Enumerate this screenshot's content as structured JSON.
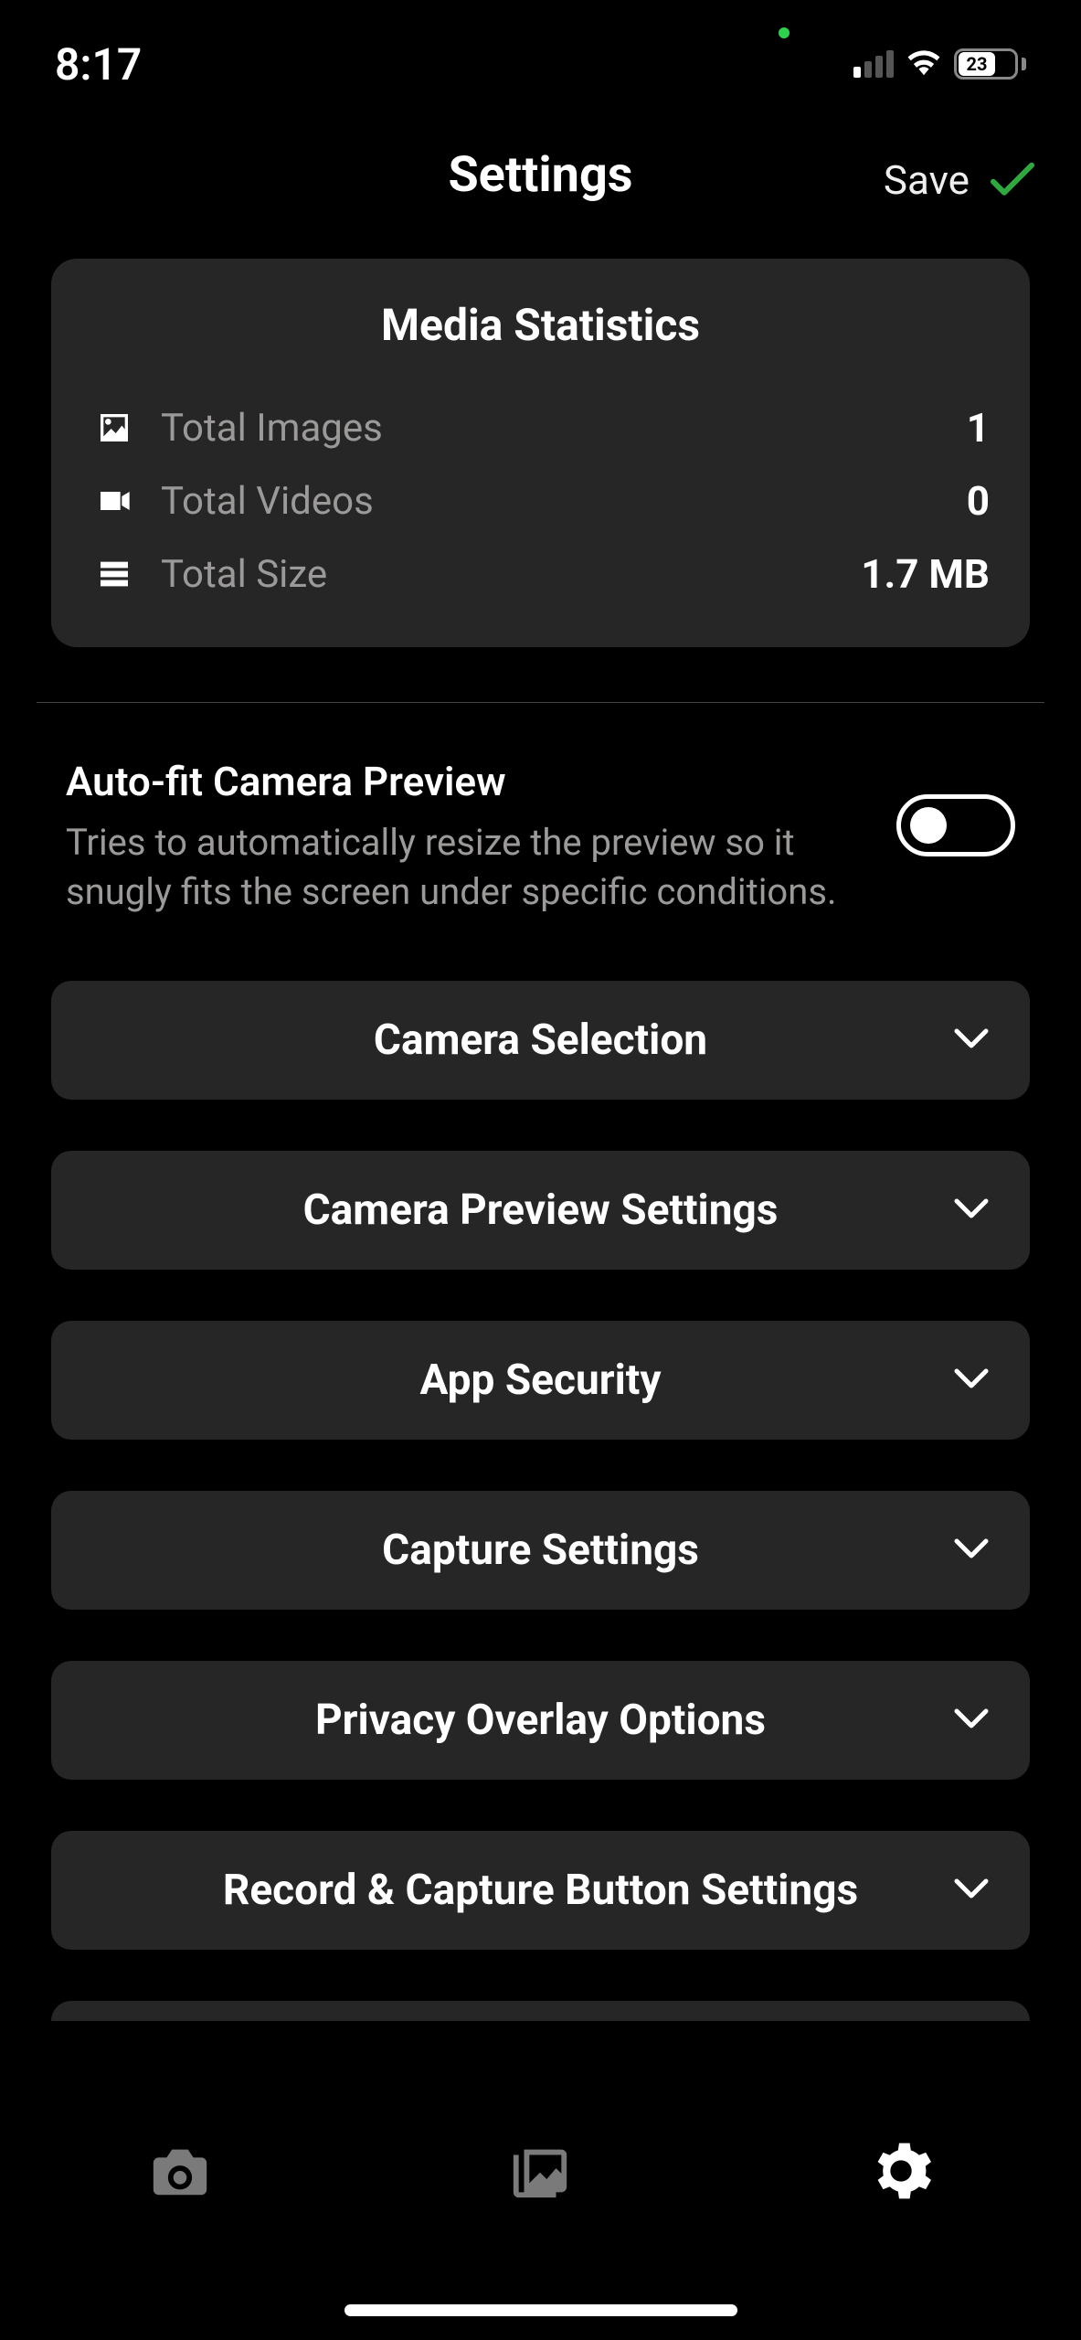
{
  "status": {
    "time": "8:17",
    "battery_pct": "23"
  },
  "header": {
    "title": "Settings",
    "save_label": "Save"
  },
  "stats": {
    "title": "Media Statistics",
    "rows": [
      {
        "label": "Total Images",
        "value": "1"
      },
      {
        "label": "Total Videos",
        "value": "0"
      },
      {
        "label": "Total Size",
        "value": "1.7 MB"
      }
    ]
  },
  "autofit": {
    "title": "Auto-fit Camera Preview",
    "desc": "Tries to automatically resize the preview so it snugly fits the screen under specific conditions.",
    "enabled": false
  },
  "sections": [
    {
      "label": "Camera Selection"
    },
    {
      "label": "Camera Preview Settings"
    },
    {
      "label": "App Security"
    },
    {
      "label": "Capture Settings"
    },
    {
      "label": "Privacy Overlay Options"
    },
    {
      "label": "Record & Capture Button Settings"
    }
  ],
  "tabs": {
    "camera": "camera",
    "gallery": "gallery",
    "settings": "settings",
    "active": "settings"
  }
}
